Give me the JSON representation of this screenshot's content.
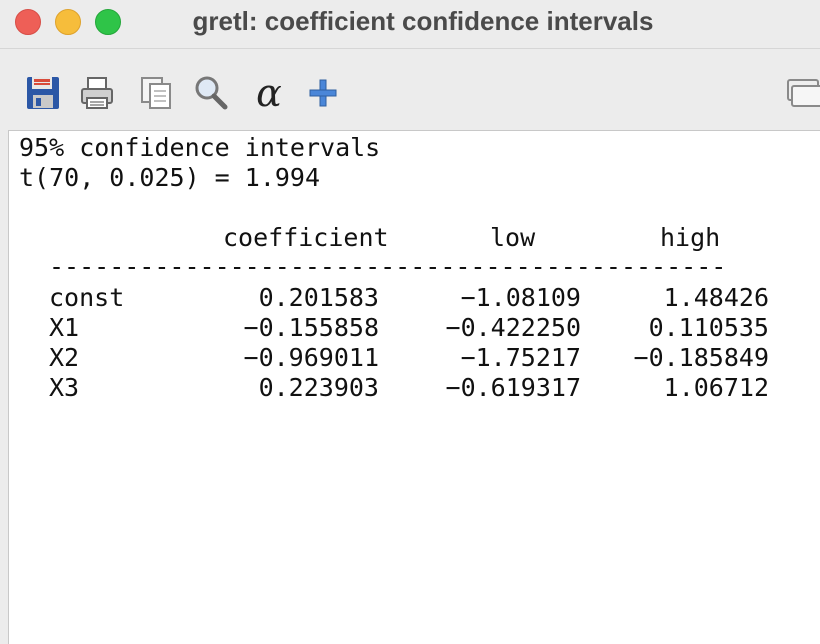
{
  "window": {
    "title": "gretl: coefficient confidence intervals"
  },
  "toolbar": {
    "buttons": [
      {
        "icon": "save-icon"
      },
      {
        "icon": "print-icon"
      },
      {
        "icon": "copy-icon"
      },
      {
        "icon": "find-icon"
      },
      {
        "icon": "alpha-icon",
        "glyph": "α"
      },
      {
        "icon": "add-icon"
      },
      {
        "icon": "windows-icon"
      }
    ]
  },
  "output": {
    "heading": "95% confidence intervals",
    "tstat": "t(70, 0.025) = 1.994",
    "columns": {
      "coefficient": "coefficient",
      "low": "low",
      "high": "high"
    },
    "separator": "---------------------------------------------",
    "rows": [
      {
        "name": "const",
        "coefficient": "0.201583",
        "low": "−1.08109",
        "high": "1.48426"
      },
      {
        "name": "X1",
        "coefficient": "−0.155858",
        "low": "−0.422250",
        "high": "0.110535"
      },
      {
        "name": "X2",
        "coefficient": "−0.969011",
        "low": "−1.75217",
        "high": "−0.185849"
      },
      {
        "name": "X3",
        "coefficient": "0.223903",
        "low": "−0.619317",
        "high": "1.06712"
      }
    ]
  }
}
